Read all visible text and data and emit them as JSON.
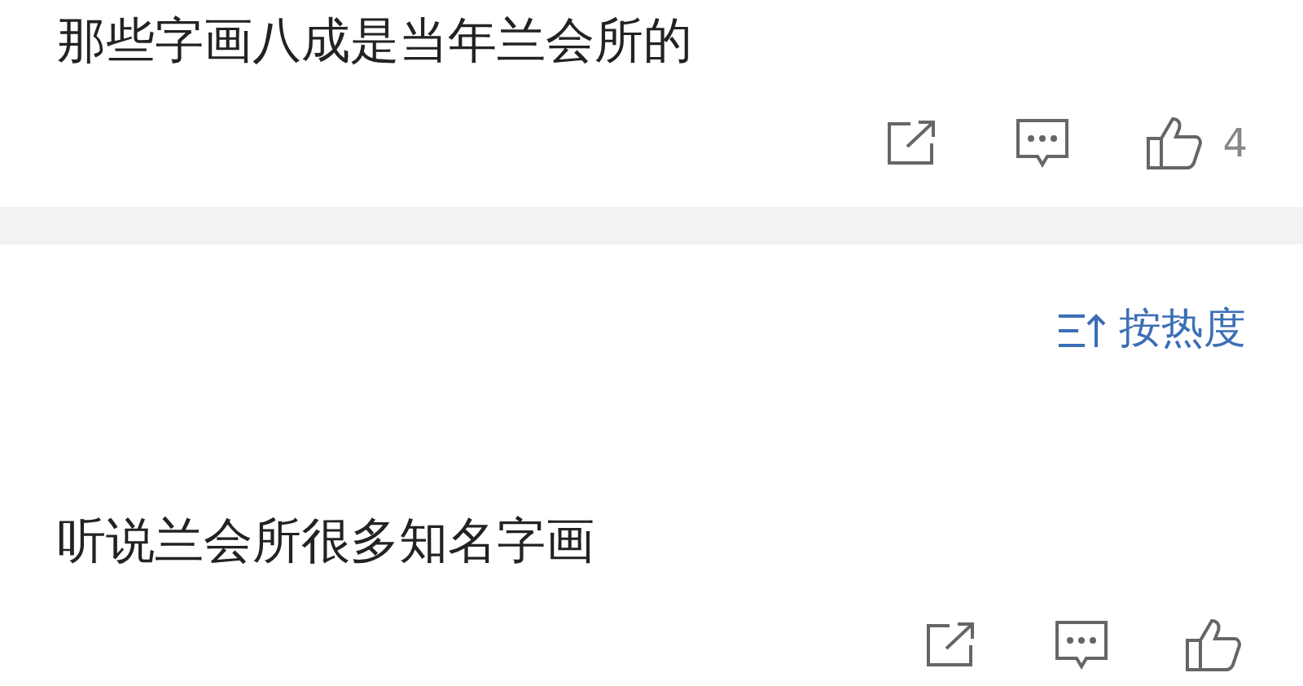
{
  "comments": [
    {
      "text": "那些字画八成是当年兰会所的",
      "likes": "4"
    },
    {
      "text": "听说兰会所很多知名字画"
    }
  ],
  "sort": {
    "label": "按热度"
  }
}
